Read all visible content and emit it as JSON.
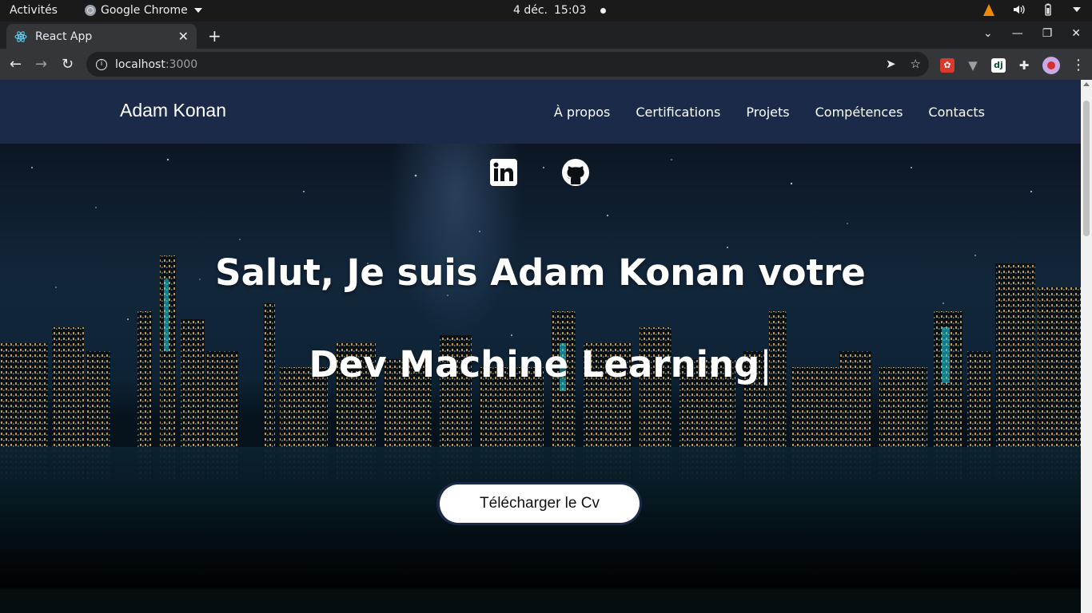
{
  "system_bar": {
    "activities": "Activités",
    "app_name": "Google Chrome",
    "date": "4 déc.",
    "time": "15:03"
  },
  "browser": {
    "tab_title": "React App",
    "url_host": "localhost",
    "url_port": ":3000"
  },
  "site": {
    "brand": "Adam Konan",
    "nav": [
      "À propos",
      "Certifications",
      "Projets",
      "Compétences",
      "Contacts"
    ],
    "hero": {
      "headline": "Salut, Je suis Adam Konan votre",
      "typed_text": "Dev Machine Learning",
      "typed_cursor": "|",
      "cv_button": "Télécharger le Cv"
    },
    "socials": [
      "linkedin-icon",
      "github-icon"
    ]
  },
  "colors": {
    "nav_bg": "#1a2a48",
    "button_bg": "#ffffff",
    "chrome_dark": "#202124",
    "chrome_toolbar": "#35363a"
  }
}
